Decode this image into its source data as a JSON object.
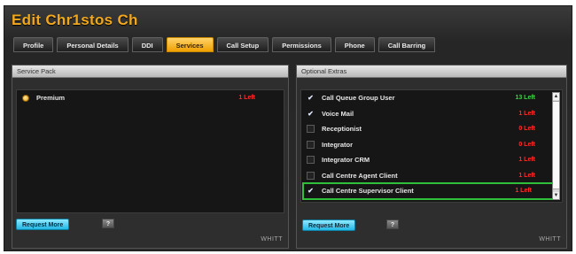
{
  "window": {
    "title": "Edit Chr1stos Ch"
  },
  "tabs": [
    {
      "label": "Profile"
    },
    {
      "label": "Personal Details"
    },
    {
      "label": "DDI"
    },
    {
      "label": "Services"
    },
    {
      "label": "Call Setup"
    },
    {
      "label": "Permissions"
    },
    {
      "label": "Phone"
    },
    {
      "label": "Call Barring"
    }
  ],
  "service_pack": {
    "header": "Service Pack",
    "items": [
      {
        "label": "Premium",
        "count": "1 Left",
        "selected": true
      }
    ],
    "request_more": "Request More",
    "help": "?",
    "brand": "WHITT"
  },
  "optional_extras": {
    "header": "Optional Extras",
    "items": [
      {
        "label": "Call Queue Group User",
        "count": "13 Left",
        "checked": true,
        "status": "green"
      },
      {
        "label": "Voice Mail",
        "count": "1 Left",
        "checked": true,
        "status": "red"
      },
      {
        "label": "Receptionist",
        "count": "0 Left",
        "checked": false,
        "status": "red"
      },
      {
        "label": "Integrator",
        "count": "0 Left",
        "checked": false,
        "status": "red"
      },
      {
        "label": "Integrator CRM",
        "count": "1 Left",
        "checked": false,
        "status": "red"
      },
      {
        "label": "Call Centre Agent Client",
        "count": "1 Left",
        "checked": false,
        "status": "red"
      },
      {
        "label": "Call Centre Supervisor Client",
        "count": "1 Left",
        "checked": true,
        "status": "red",
        "highlighted": true
      }
    ],
    "request_more": "Request More",
    "help": "?",
    "brand": "WHITT"
  },
  "colors": {
    "accent": "#f2a81d",
    "active_tab": "#f0a000",
    "count_green": "#3fd24a",
    "count_red": "#ff2a2a",
    "highlight": "#2fbf3a",
    "button": "#22b8e5"
  }
}
